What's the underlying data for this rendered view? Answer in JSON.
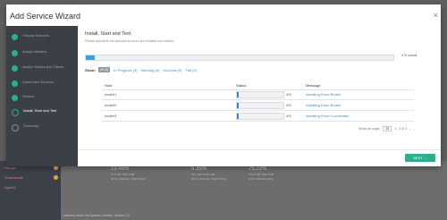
{
  "modal": {
    "title": "Add Service Wizard",
    "close_glyph": "×"
  },
  "steps": [
    {
      "label": "Choose Services",
      "state": "done"
    },
    {
      "label": "Assign Masters",
      "state": "done"
    },
    {
      "label": "Assign Slaves and Clients",
      "state": "done"
    },
    {
      "label": "Customize Services",
      "state": "done"
    },
    {
      "label": "Review",
      "state": "done"
    },
    {
      "label": "Install, Start and Test",
      "state": "active"
    },
    {
      "label": "Summary",
      "state": "pending"
    }
  ],
  "main": {
    "title": "Install, Start and Test",
    "subtitle": "Please wait while the selected services are installed and started.",
    "overall_progress": 0.03,
    "overall_label": "4 % overall"
  },
  "filters": {
    "show_label": "Show:",
    "all": "All (3)",
    "in_progress": "In Progress (3)",
    "warning": "Warning (0)",
    "success": "Success (0)",
    "fail": "Fail (0)"
  },
  "table": {
    "headers": {
      "host": "Host",
      "status": "Status",
      "message": "Message"
    },
    "rows": [
      {
        "host": "node01",
        "progress": 0.04,
        "pct": "4%",
        "message": "Installing Druid Broker"
      },
      {
        "host": "node02",
        "progress": 0.04,
        "pct": "4%",
        "message": "Installing Druid Broker"
      },
      {
        "host": "node03",
        "progress": 0.04,
        "pct": "4%",
        "message": "Installing Druid Coordinator"
      }
    ]
  },
  "pager": {
    "items_label": "Items per page:",
    "per_page": "25",
    "range": "1 - 3 of 3"
  },
  "next_button": "NEXT →",
  "background": {
    "sidebar_items": [
      "Ranger",
      "Smartsense",
      "Spark2"
    ],
    "stats": [
      {
        "value": "19.45%",
        "sub": "97.7 GB / 465.9 GB",
        "label": "DISK USAGE (/DEV/SDA)"
      },
      {
        "value": "5.35%",
        "sub": "29.1 GB / 545.0 GB",
        "label": "DISK USAGE (/DEV/SDA)"
      },
      {
        "value": "75.23%",
        "sub": "376.9 GB / 500.9 GB",
        "label": "DISK REMAINING"
      }
    ],
    "footer": "Licensed under the Apache License, Version 2.0."
  }
}
